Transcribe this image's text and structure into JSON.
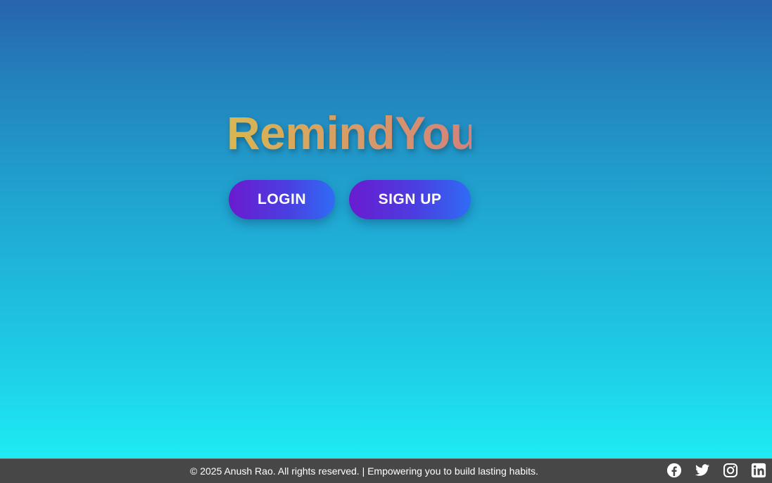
{
  "app": {
    "title": "RemindYou"
  },
  "actions": {
    "login_label": "LOGIN",
    "signup_label": "SIGN UP"
  },
  "footer": {
    "text": "© 2025 Anush Rao. All rights reserved. | Empowering you to build lasting habits.",
    "socials": [
      "facebook-icon",
      "twitter-icon",
      "instagram-icon",
      "linkedin-icon"
    ]
  },
  "colors": {
    "background_top": "#2764ae",
    "background_bottom": "#1ef3f7",
    "button_gradient_start": "#6a1bcf",
    "button_gradient_end": "#2f6cf5",
    "title_gradient_start": "#d9b751",
    "title_gradient_end": "#d4827a",
    "footer_bg": "#474747"
  }
}
